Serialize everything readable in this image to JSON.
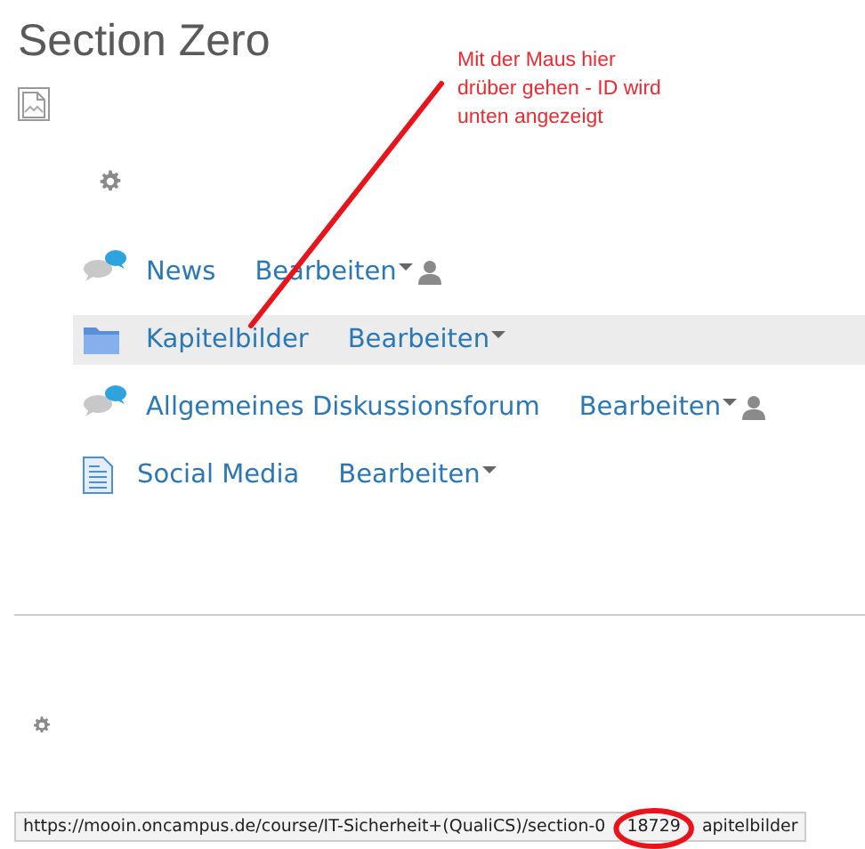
{
  "section": {
    "title": "Section Zero"
  },
  "activities": [
    {
      "kind": "forum",
      "name": "News",
      "edit": "Bearbeiten",
      "group_icon": true,
      "hovered": false
    },
    {
      "kind": "folder",
      "name": "Kapitelbilder",
      "edit": "Bearbeiten",
      "group_icon": false,
      "hovered": true
    },
    {
      "kind": "forum",
      "name": "Allgemeines Diskussionsforum",
      "edit": "Bearbeiten",
      "group_icon": true,
      "hovered": false
    },
    {
      "kind": "page",
      "name": "Social Media",
      "edit": "Bearbeiten",
      "group_icon": false,
      "hovered": false
    }
  ],
  "annotation": {
    "text": "Mit der Maus hier\ndrüber gehen - ID wird\nunten angezeigt"
  },
  "status_bar": {
    "url_start": "https://mooin.oncampus.de/course/IT-Sicherheit+(QualiCS)/section-0",
    "url_id": "18729",
    "url_end": "apitelbilder"
  }
}
